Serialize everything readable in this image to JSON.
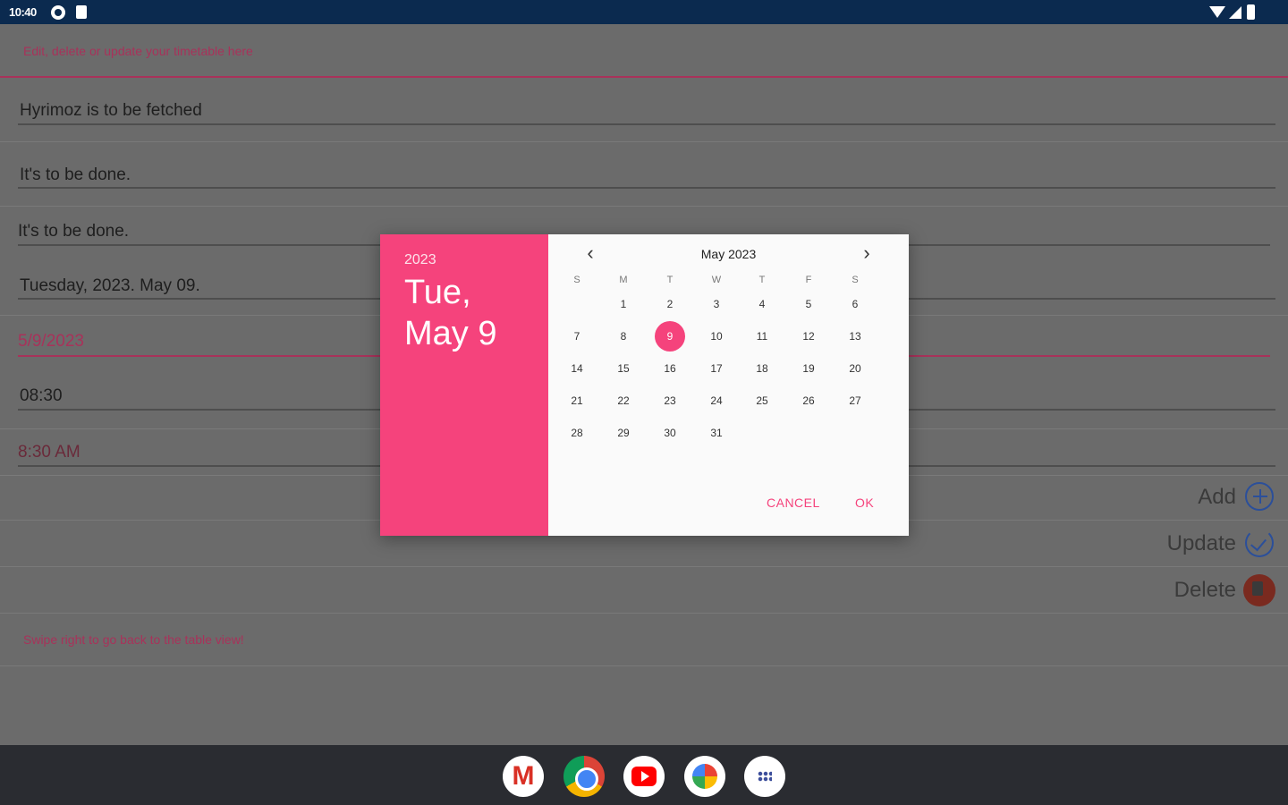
{
  "status_bar": {
    "time": "10:40",
    "left_icons": [
      "sync-icon",
      "sd-card-icon"
    ],
    "right_icons": [
      "wifi-icon",
      "signal-icon",
      "battery-icon"
    ]
  },
  "screen": {
    "hint_top": "Edit, delete or update your timetable here",
    "fields": [
      "Hyrimoz is to be fetched",
      "It's to be done.",
      "It's to be done.",
      "Tuesday, 2023. May 09.",
      "5/9/2023",
      "08:30",
      "8:30 AM"
    ],
    "actions": {
      "add_label": "Add",
      "update_label": "Update",
      "delete_label": "Delete"
    },
    "hint_bottom": "Swipe right to go back to the table view!"
  },
  "date_picker": {
    "year": "2023",
    "selected_date": "Tue, May 9",
    "month_title": "May 2023",
    "weekdays": [
      "S",
      "M",
      "T",
      "W",
      "T",
      "F",
      "S"
    ],
    "days": [
      "1",
      "2",
      "3",
      "4",
      "5",
      "6",
      "7",
      "8",
      "9",
      "10",
      "11",
      "12",
      "13",
      "14",
      "15",
      "16",
      "17",
      "18",
      "19",
      "20",
      "21",
      "22",
      "23",
      "24",
      "25",
      "26",
      "27",
      "28",
      "29",
      "30",
      "31"
    ],
    "selected_day": "9",
    "cancel_label": "CANCEL",
    "ok_label": "OK",
    "accent_color": "#f5437c"
  },
  "dock": {
    "apps": [
      "gmail-icon",
      "chrome-icon",
      "youtube-icon",
      "photos-icon",
      "app-launcher-icon"
    ]
  }
}
